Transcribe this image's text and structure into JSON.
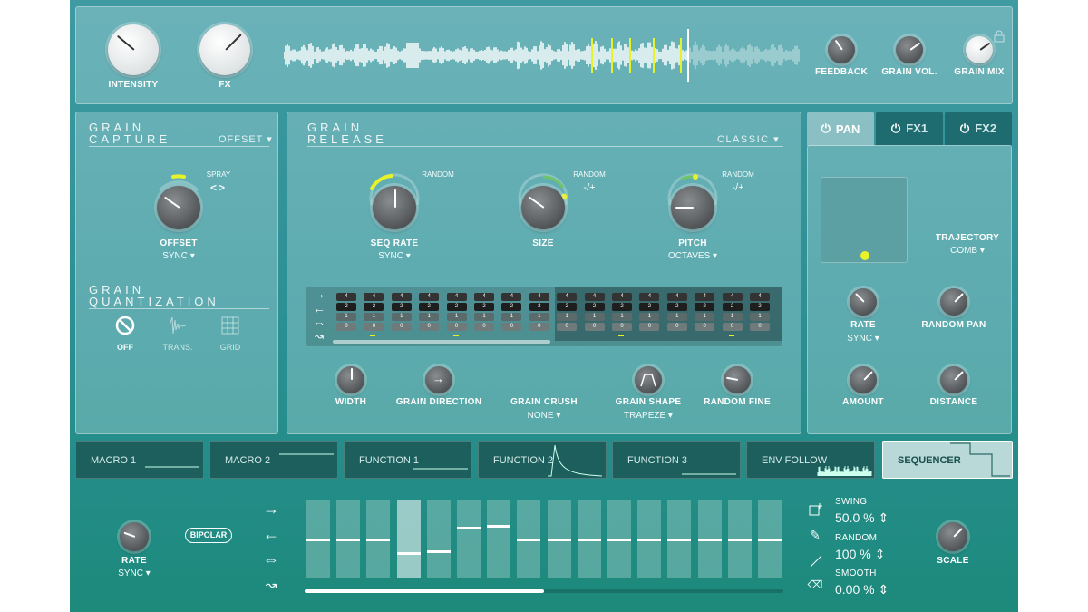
{
  "top": {
    "knobs": [
      {
        "label": "INTENSITY"
      },
      {
        "label": "FX"
      }
    ],
    "right_knobs": [
      {
        "label": "FEEDBACK"
      },
      {
        "label": "GRAIN VOL."
      },
      {
        "label": "GRAIN MIX"
      }
    ]
  },
  "capture": {
    "title_line1": "GRAIN",
    "title_line2": "CAPTURE",
    "mode": "OFFSET",
    "spray_label": "SPRAY",
    "spray_symbol": "<>",
    "offset_label": "OFFSET",
    "offset_sub": "SYNC"
  },
  "quant": {
    "title_line1": "GRAIN",
    "title_line2": "QUANTIZATION",
    "options": [
      {
        "label": "OFF",
        "icon": "off-icon"
      },
      {
        "label": "TRANS.",
        "icon": "transient-icon"
      },
      {
        "label": "GRID",
        "icon": "grid-icon"
      }
    ]
  },
  "release": {
    "title_line1": "GRAIN",
    "title_line2": "RELEASE",
    "preset": "CLASSIC",
    "knobs": [
      {
        "label": "SEQ RATE",
        "sub": "SYNC",
        "random": "RANDOM",
        "rand_sym": ""
      },
      {
        "label": "SIZE",
        "sub": "",
        "random": "RANDOM",
        "rand_sym": "-/+"
      },
      {
        "label": "PITCH",
        "sub": "OCTAVES",
        "random": "RANDOM",
        "rand_sym": "-/+"
      }
    ],
    "small": [
      {
        "label": "WIDTH",
        "sub": ""
      },
      {
        "label": "GRAIN DIRECTION",
        "sub": ""
      },
      {
        "label": "GRAIN CRUSH",
        "sub": "NONE"
      },
      {
        "label": "GRAIN SHAPE",
        "sub": "TRAPEZE"
      },
      {
        "label": "RANDOM FINE",
        "sub": ""
      }
    ],
    "grid_values": [
      "4",
      "2",
      "1",
      "0"
    ]
  },
  "right": {
    "tabs": [
      {
        "label": "PAN"
      },
      {
        "label": "FX1"
      },
      {
        "label": "FX2"
      }
    ],
    "trajectory_label": "TRAJECTORY",
    "trajectory_value": "COMB",
    "rate_label": "RATE",
    "rate_sub": "SYNC",
    "random_pan_label": "RANDOM PAN",
    "amount_label": "AMOUNT",
    "distance_label": "DISTANCE"
  },
  "modulators": [
    {
      "label": "MACRO 1"
    },
    {
      "label": "MACRO 2"
    },
    {
      "label": "FUNCTION 1"
    },
    {
      "label": "FUNCTION 2"
    },
    {
      "label": "FUNCTION 3"
    },
    {
      "label": "ENV FOLLOW"
    },
    {
      "label": "SEQUENCER"
    }
  ],
  "sequencer": {
    "rate_label": "RATE",
    "rate_sub": "SYNC",
    "bipolar": "BIPOLAR",
    "scale_label": "SCALE",
    "swing_label": "SWING",
    "swing_value": "50.0 %",
    "random_label": "RANDOM",
    "random_value": "100 %",
    "smooth_label": "SMOOTH",
    "smooth_value": "0.00 %",
    "steps": [
      0.5,
      0.5,
      0.5,
      0.33,
      0.35,
      0.65,
      0.67,
      0.5,
      0.5,
      0.5,
      0.5,
      0.5,
      0.5,
      0.5,
      0.5,
      0.5
    ]
  },
  "colors": {
    "accent": "#e8f22a",
    "tab_active": "#cfe3e4",
    "tab_inactive": "#1f6c70"
  }
}
